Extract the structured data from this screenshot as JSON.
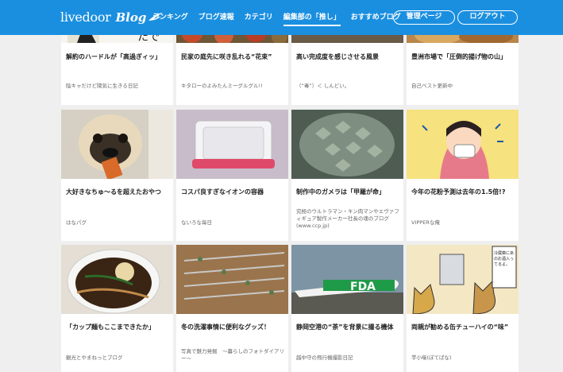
{
  "header": {
    "logo_text": "livedoor",
    "logo_blog": "Blog",
    "nav": [
      "ランキング",
      "ブログ速報",
      "カテゴリ",
      "編集部の「推し」",
      "おすすめブログ"
    ],
    "manage_label": "管理ページ",
    "logout_label": "ログアウト"
  },
  "rows": [
    [
      {
        "title": "解約のハードルが「高過ぎィッ」",
        "blog": "陰キャだけど陽気に生きる日記"
      },
      {
        "title": "民家の庭先に咲き乱れる“花束”",
        "blog": "キタローのよみたんミーグルグル!!"
      },
      {
        "title": "高い完成度を感じさせる風景",
        "blog": "（“毒”）＜ しんどい。"
      },
      {
        "title": "豊洲市場で「圧倒的揚げ物の山」",
        "blog": "自己ベスト更新中"
      }
    ],
    [
      {
        "title": "大好きなちゅ～るを超えたおやつ",
        "blog": "はなパグ"
      },
      {
        "title": "コスパ良すぎなイオンの容器",
        "blog": "ないろな毎日"
      },
      {
        "title": "制作中のガメラは「甲羅が命」",
        "blog": "究極のウルトラマン・キン肉マンやエヴァフィギュア製作メーカー社長の魂のブログ(www.ccp.jp)"
      },
      {
        "title": "今年の花粉予測は去年の1.5倍!?",
        "blog": "VIPPERな俺"
      }
    ],
    [
      {
        "title": "「カップ麺もここまできたか」",
        "blog": "観光とやまねっとブログ"
      },
      {
        "title": "冬の洗濯事情に便利なグッズ！",
        "blog": "写真で魅力発掘　～暮らしのフォトダイアリー～"
      },
      {
        "title": "静岡空港の“茶”を背景に撮る機体",
        "blog": "越中守の飛行機撮影日記"
      },
      {
        "title": "両親が勧める缶チューハイの“味”",
        "blog": "芋小噺(ぽてぱな)"
      }
    ]
  ],
  "thumb_texts": {
    "plane_livery": "FDA",
    "comic_speech": "冷蔵庫にあのお酒入ってるよ。",
    "partial_sign": "たで"
  }
}
